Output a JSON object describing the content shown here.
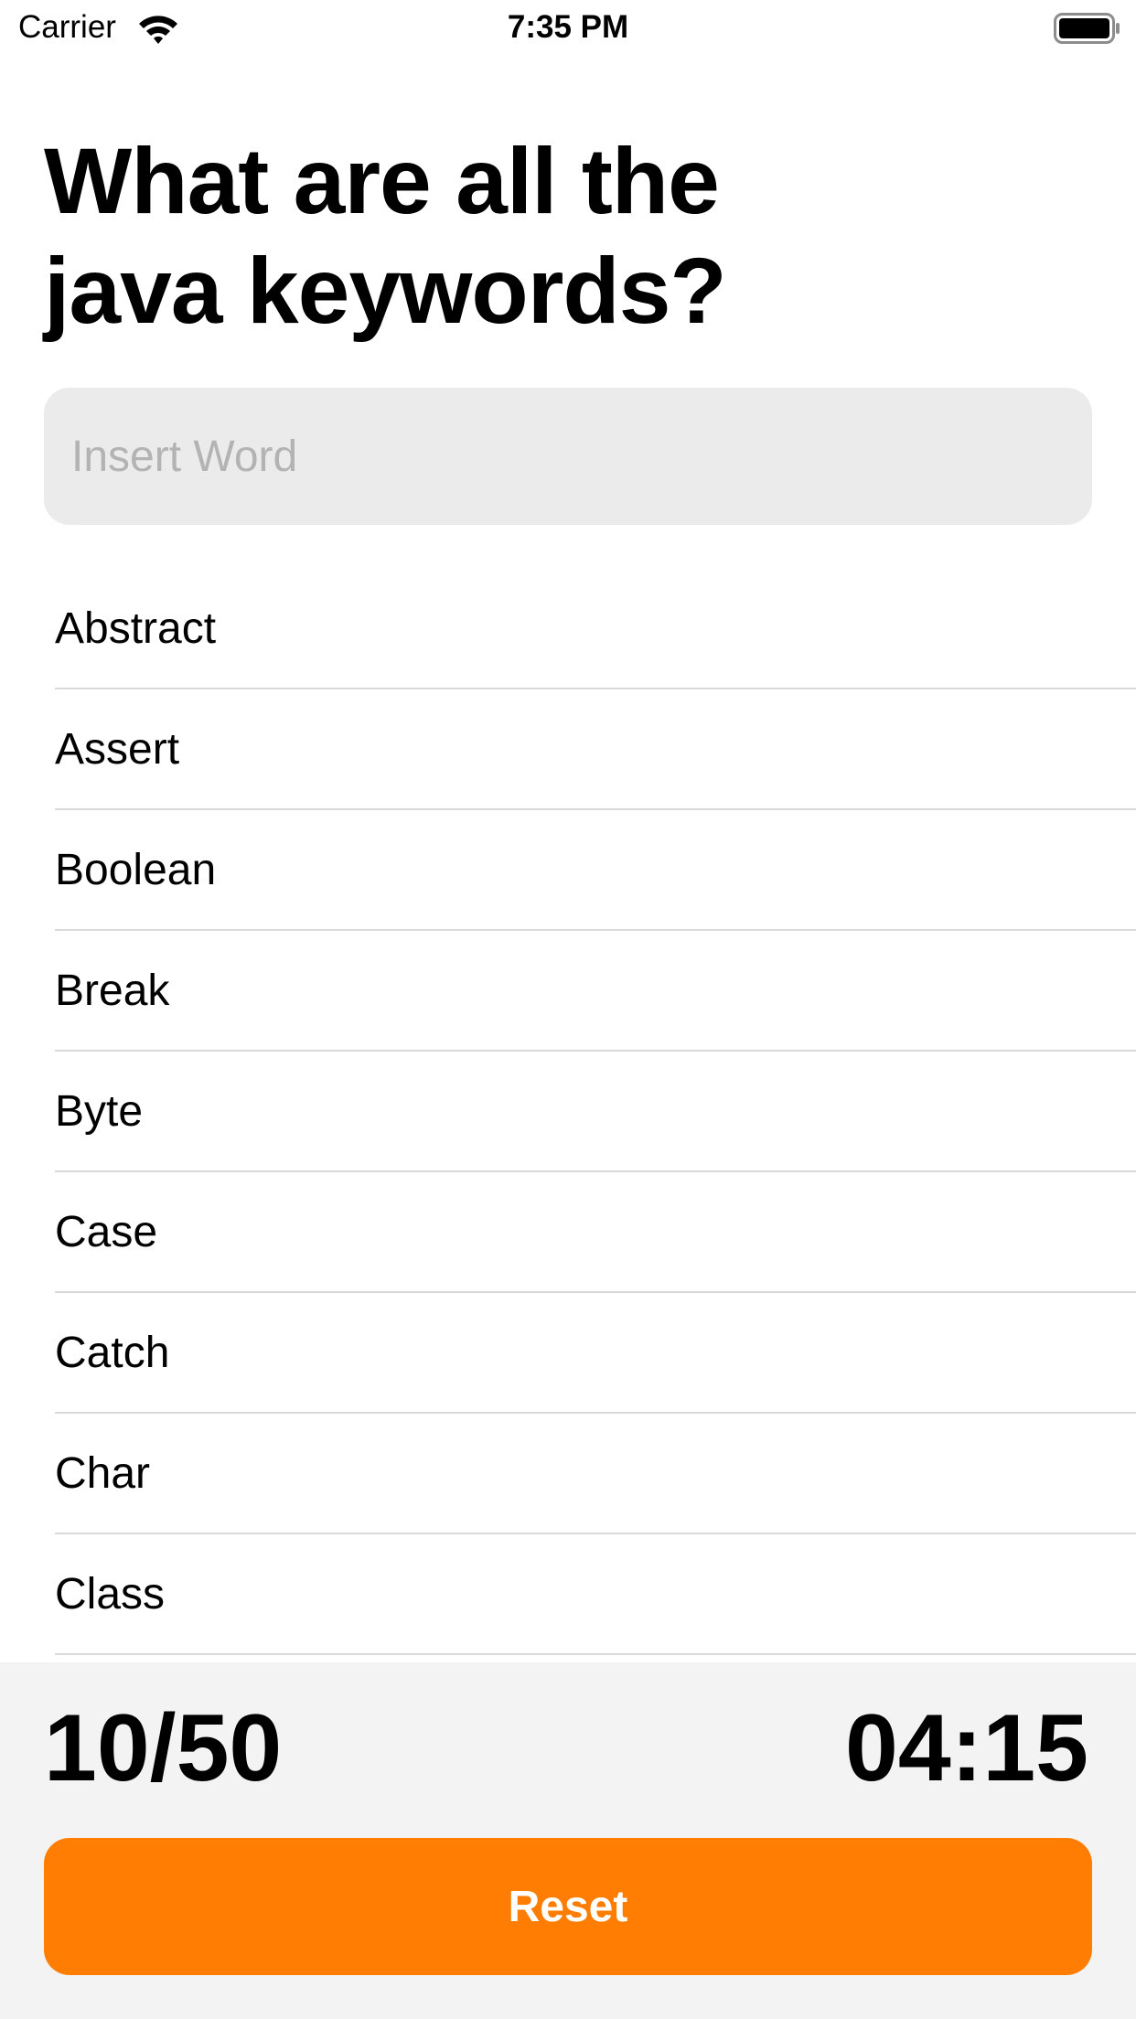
{
  "status_bar": {
    "carrier": "Carrier",
    "time": "7:35 PM",
    "wifi_icon": "wifi-icon",
    "battery_icon": "battery-icon"
  },
  "question": {
    "line1": "What are all the",
    "line2": "java keywords?"
  },
  "input": {
    "placeholder": "Insert Word",
    "value": ""
  },
  "words": [
    "Abstract",
    "Assert",
    "Boolean",
    "Break",
    "Byte",
    "Case",
    "Catch",
    "Char",
    "Class"
  ],
  "footer": {
    "score": "10/50",
    "timer": "04:15",
    "reset_label": "Reset"
  },
  "colors": {
    "accent": "#ff7d03",
    "input_bg": "#ebebeb",
    "footer_bg": "#f3f3f3",
    "separator": "#d9d9d9"
  }
}
